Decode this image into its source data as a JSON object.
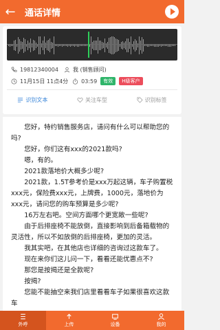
{
  "header": {
    "title": "通话详情",
    "back_icon": "arrow-left-icon",
    "play_icon": "play-icon"
  },
  "call": {
    "phone": "19812340004",
    "agent": "我 (销售顾问)",
    "date": "11月15日 11点4分",
    "duration": "03:59",
    "tag_valid": "有效",
    "tag_level": "H级客户"
  },
  "actions": [
    {
      "label": "识别文本",
      "icon": "list-icon"
    },
    {
      "label": "关注车型",
      "icon": "heart-icon"
    },
    {
      "label": "识别标签",
      "icon": "tag-icon"
    }
  ],
  "transcript": [
    "您好，特约销售服务店，请问有什么可以帮助您的吗?",
    "您好，你们这有xxx的2021款吗?",
    "嗯，有的。",
    "2021款落地价大概多少呢?",
    "2021款，1.5T参考价是xxx万起这辆，车子购置税xxx元，保险费xxx元，上牌费，1000元，落地价为xxx元，请问您的购车预算是多少呢?",
    "16万左右吧。空间方面哪个更宽敞一些呢?",
    "由于后排座椅不能放倒，直接影响到后备箱载物的灵活性，所以不如放倒的后排座椅，更加的灵活。",
    "我其实吧，在其他店也详细的咨询过这款车了。",
    "现在来你们这儿问一下，看看还能优惠点不?",
    "那您是按揭还是全款呢?",
    "按揭?",
    "您能不能抽空来我们店里看看车子如果很喜欢这款车"
  ],
  "tabs": [
    {
      "label": "外呼",
      "icon": "phone-list-icon",
      "active": true
    },
    {
      "label": "上传",
      "icon": "upload-icon",
      "active": false
    },
    {
      "label": "设备",
      "icon": "device-icon",
      "active": false
    },
    {
      "label": "我的",
      "icon": "user-icon",
      "active": false
    }
  ],
  "colors": {
    "brand": "#f26a2e",
    "accent_blue": "#3a86d9",
    "tag_green": "#2fb56a",
    "tag_red": "#ec4d5b",
    "waveform_cursor": "#2ed15a"
  }
}
